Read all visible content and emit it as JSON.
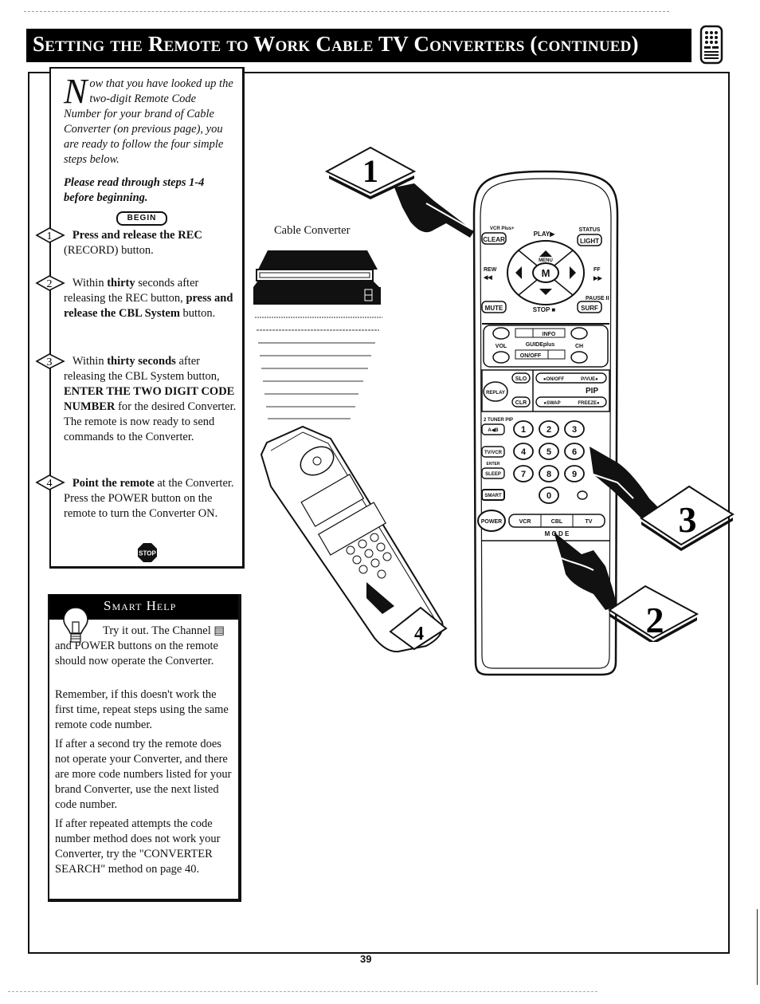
{
  "header": {
    "title": "Setting the Remote to Work Cable TV Converters (continued)",
    "icon": "remote-control-icon"
  },
  "intro": {
    "dropcap": "N",
    "text": "ow that you have looked up the two-digit Remote Code Number for your brand of Cable Converter (on previous page), you are ready to follow the four simple steps below.",
    "note": "Please read through steps 1-4 before beginning.",
    "begin_label": "BEGIN"
  },
  "steps": [
    {
      "number": "1",
      "bold": "Press and release the REC",
      "rest": " (RECORD) button."
    },
    {
      "number": "2",
      "pre": "Within ",
      "bold1": "thirty",
      "mid1": " seconds after releasing the REC button, ",
      "bold2": "press and release the CBL System",
      "post": " button."
    },
    {
      "number": "3",
      "pre": "Within ",
      "bold1": "thirty seconds",
      "mid1": " after releasing the CBL System button, ",
      "bold2": "ENTER THE TWO DIGIT CODE NUMBER",
      "post": " for the desired Converter. The remote is now ready to send commands to the Converter."
    },
    {
      "number": "4",
      "bold": "Point the remote",
      "rest": " at the Converter. Press the POWER button on the remote to turn the Converter ON."
    }
  ],
  "stop_label": "STOP",
  "smart_help": {
    "title": "Smart Help",
    "paragraphs": [
      "Try it out. The Channel ▤ and POWER buttons on the remote should now operate the Converter.",
      "Remember, if this doesn't work the first time, repeat steps using the same remote code number.",
      "If after a second try the remote does not operate your Converter, and there are more code numbers listed for your brand Converter, use the next listed code number.",
      "If after repeated attempts the code number method does not work your Converter, try the \"CONVERTER SEARCH\" method on page 40."
    ]
  },
  "illustration": {
    "converter_label": "Cable Converter",
    "callouts": [
      "1",
      "2",
      "3",
      "4"
    ],
    "remote": {
      "top_labels": {
        "vcr_plus": "VCR Plus+",
        "clear": "CLEAR",
        "play": "PLAY▶",
        "status": "STATUS",
        "light": "LIGHT",
        "rew": "REW",
        "rew_sym": "◀◀",
        "ff": "FF",
        "ff_sym": "▶▶",
        "menu": "MENU",
        "m": "M",
        "pause": "PAUSE II",
        "mute": "MUTE",
        "stop": "STOP ■",
        "surf": "SURF"
      },
      "mid_labels": {
        "vol": "VOL",
        "ch": "CH",
        "info": "INFO",
        "guide": "GUIDEplus",
        "onoff": "ON/OFF"
      },
      "pip_labels": {
        "replay": "REPLAY",
        "slo": "SLO",
        "clr": "CLR",
        "pip_onoff": "●ON/OFF",
        "pip_pvue": "P/VUE●",
        "pip": "PIP",
        "swap": "●SWAP",
        "freeze": "FREEZE●"
      },
      "keypad_labels": {
        "two_tuner": "2 TUNER PIP",
        "ab": "A◀B",
        "tvvcr": "TV/VCR",
        "enter": "ENTER",
        "sleep": "SLEEP",
        "smart": "SMART",
        "power": "POWER",
        "vcr": "VCR",
        "cbl": "CBL",
        "tv": "TV",
        "mode": "M  O  D  E"
      },
      "digits": [
        "1",
        "2",
        "3",
        "4",
        "5",
        "6",
        "7",
        "8",
        "9",
        "0"
      ]
    }
  },
  "page_number": "39"
}
